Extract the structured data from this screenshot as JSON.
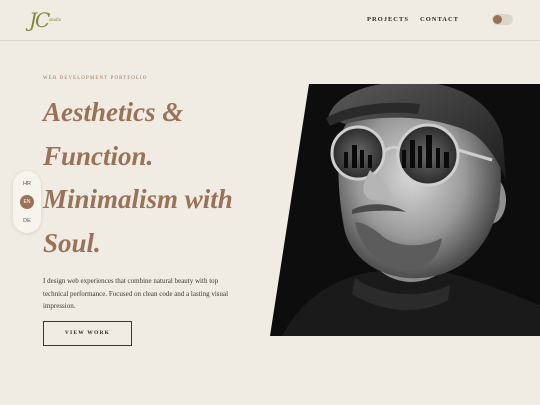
{
  "header": {
    "logo_mark": "JC",
    "logo_text": "studio",
    "nav": [
      {
        "label": "PROJECTS"
      },
      {
        "label": "CONTACT"
      }
    ],
    "theme_toggle": {
      "state": "light"
    }
  },
  "languages": {
    "items": [
      "HR",
      "EN",
      "DE"
    ],
    "selected": "EN"
  },
  "hero": {
    "eyebrow": "WEB DEVELOPMENT PORTFOLIO",
    "headline_lines": [
      "Aesthetics &",
      "Function.",
      "Minimalism with",
      "Soul."
    ],
    "description": "I design web experiences that combine natural beauty with top technical performance. Focused on clean code and a lasting visual impression.",
    "cta_label": "VIEW WORK"
  },
  "colors": {
    "background": "#f0ece3",
    "accent": "#9a7258",
    "logo_green": "#7d8a3a"
  },
  "icons": {
    "theme_toggle": "theme-toggle-icon",
    "portrait": "portrait-photo"
  }
}
